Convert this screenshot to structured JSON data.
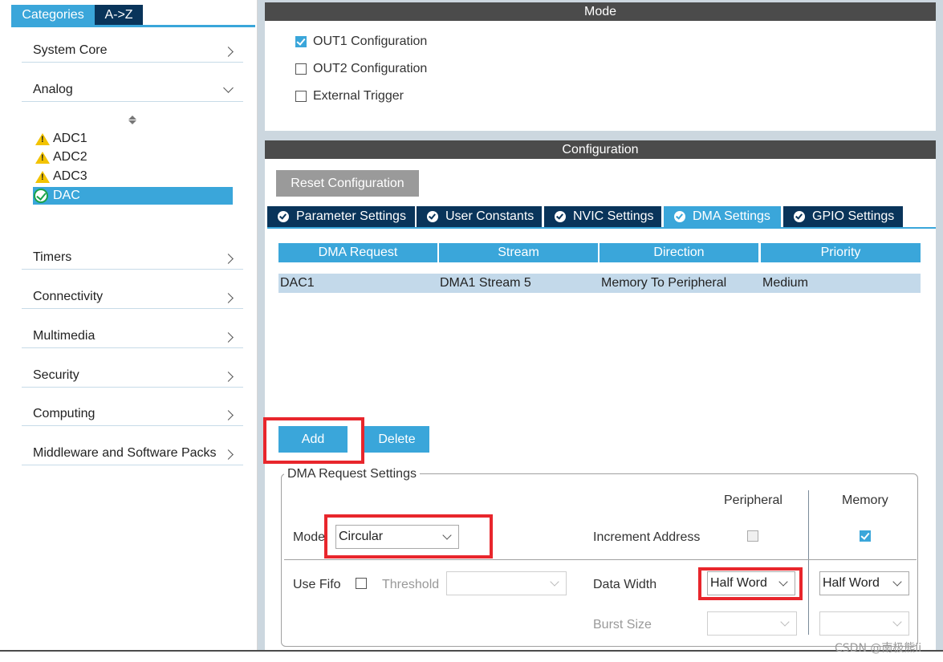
{
  "left": {
    "tabs": {
      "categories": "Categories",
      "az": "A->Z"
    },
    "categories": [
      {
        "label": "System Core"
      },
      {
        "label": "Analog"
      },
      {
        "label": "Timers"
      },
      {
        "label": "Connectivity"
      },
      {
        "label": "Multimedia"
      },
      {
        "label": "Security"
      },
      {
        "label": "Computing"
      },
      {
        "label": "Middleware and Software Packs"
      }
    ],
    "analog_items": [
      {
        "label": "ADC1",
        "status_icon": "warning-icon"
      },
      {
        "label": "ADC2",
        "status_icon": "warning-icon"
      },
      {
        "label": "ADC3",
        "status_icon": "warning-icon"
      },
      {
        "label": "DAC",
        "status_icon": "check-circle-icon",
        "selected": true
      }
    ]
  },
  "mode": {
    "title": "Mode",
    "options": [
      {
        "label": "OUT1 Configuration",
        "checked": true
      },
      {
        "label": "OUT2 Configuration",
        "checked": false
      },
      {
        "label": "External Trigger",
        "checked": false
      }
    ]
  },
  "configuration": {
    "title": "Configuration",
    "reset_label": "Reset Configuration",
    "tabs": [
      {
        "label": "Parameter Settings"
      },
      {
        "label": "User Constants"
      },
      {
        "label": "NVIC Settings"
      },
      {
        "label": "DMA Settings",
        "active": true
      },
      {
        "label": "GPIO Settings"
      }
    ],
    "dma_table": {
      "headers": [
        "DMA Request",
        "Stream",
        "Direction",
        "Priority"
      ],
      "rows": [
        [
          "DAC1",
          "DMA1 Stream 5",
          "Memory To Peripheral",
          "Medium"
        ]
      ]
    },
    "add_label": "Add",
    "delete_label": "Delete",
    "request_settings": {
      "legend": "DMA Request Settings",
      "peripheral_label": "Peripheral",
      "memory_label": "Memory",
      "mode_label": "Mode",
      "mode_value": "Circular",
      "increment_label": "Increment Address",
      "peripheral_increment": false,
      "memory_increment": true,
      "use_fifo_label": "Use Fifo",
      "use_fifo": false,
      "threshold_label": "Threshold",
      "threshold_value": "",
      "data_width_label": "Data Width",
      "peripheral_data_width": "Half Word",
      "memory_data_width": "Half Word",
      "burst_size_label": "Burst Size",
      "peripheral_burst": "",
      "memory_burst": ""
    }
  },
  "watermark": "CSDN @南极熊ii",
  "colors": {
    "accent": "#3aa6da",
    "dark_tab": "#09345a",
    "highlight": "#e8262c",
    "header": "#4b4b4b"
  }
}
